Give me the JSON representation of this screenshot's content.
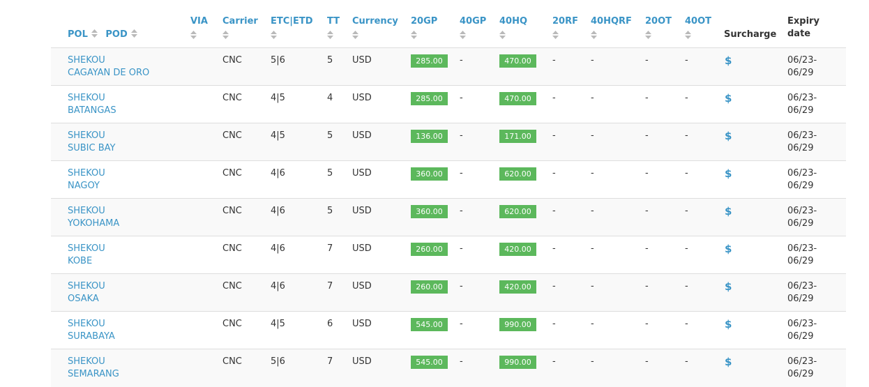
{
  "headers": {
    "pol": "POL",
    "pod": "POD",
    "via": "VIA",
    "carrier": "Carrier",
    "etc_etd": "ETC|ETD",
    "tt": "TT",
    "currency": "Currency",
    "c20gp": "20GP",
    "c40gp": "40GP",
    "c40hq": "40HQ",
    "c20rf": "20RF",
    "c40hqrf": "40HQRF",
    "c20ot": "20OT",
    "c40ot": "40OT",
    "surcharge": "Surcharge",
    "expiry_line1": "Expiry",
    "expiry_line2": "date"
  },
  "icons": {
    "sort": "sort-icon",
    "surcharge": "dollar-icon"
  },
  "colors": {
    "link": "#3a94c6",
    "badge": "#5cb85c",
    "row_stripe": "#f9f9f9"
  },
  "rows": [
    {
      "pol": "SHEKOU",
      "pod": "CAGAYAN DE ORO",
      "via": "",
      "carrier": "CNC",
      "etc_etd": "5|6",
      "tt": "5",
      "currency": "USD",
      "c20gp": "285.00",
      "c40gp": "-",
      "c40hq": "470.00",
      "c20rf": "-",
      "c40hqrf": "-",
      "c20ot": "-",
      "c40ot": "-",
      "surcharge": "$",
      "expiry_line1": "06/23-",
      "expiry_line2": "06/29"
    },
    {
      "pol": "SHEKOU",
      "pod": "BATANGAS",
      "via": "",
      "carrier": "CNC",
      "etc_etd": "4|5",
      "tt": "4",
      "currency": "USD",
      "c20gp": "285.00",
      "c40gp": "-",
      "c40hq": "470.00",
      "c20rf": "-",
      "c40hqrf": "-",
      "c20ot": "-",
      "c40ot": "-",
      "surcharge": "$",
      "expiry_line1": "06/23-",
      "expiry_line2": "06/29"
    },
    {
      "pol": "SHEKOU",
      "pod": "SUBIC BAY",
      "via": "",
      "carrier": "CNC",
      "etc_etd": "4|5",
      "tt": "5",
      "currency": "USD",
      "c20gp": "136.00",
      "c40gp": "-",
      "c40hq": "171.00",
      "c20rf": "-",
      "c40hqrf": "-",
      "c20ot": "-",
      "c40ot": "-",
      "surcharge": "$",
      "expiry_line1": "06/23-",
      "expiry_line2": "06/29"
    },
    {
      "pol": "SHEKOU",
      "pod": "NAGOY",
      "via": "",
      "carrier": "CNC",
      "etc_etd": "4|6",
      "tt": "5",
      "currency": "USD",
      "c20gp": "360.00",
      "c40gp": "-",
      "c40hq": "620.00",
      "c20rf": "-",
      "c40hqrf": "-",
      "c20ot": "-",
      "c40ot": "-",
      "surcharge": "$",
      "expiry_line1": "06/23-",
      "expiry_line2": "06/29"
    },
    {
      "pol": "SHEKOU",
      "pod": "YOKOHAMA",
      "via": "",
      "carrier": "CNC",
      "etc_etd": "4|6",
      "tt": "5",
      "currency": "USD",
      "c20gp": "360.00",
      "c40gp": "-",
      "c40hq": "620.00",
      "c20rf": "-",
      "c40hqrf": "-",
      "c20ot": "-",
      "c40ot": "-",
      "surcharge": "$",
      "expiry_line1": "06/23-",
      "expiry_line2": "06/29"
    },
    {
      "pol": "SHEKOU",
      "pod": "KOBE",
      "via": "",
      "carrier": "CNC",
      "etc_etd": "4|6",
      "tt": "7",
      "currency": "USD",
      "c20gp": "260.00",
      "c40gp": "-",
      "c40hq": "420.00",
      "c20rf": "-",
      "c40hqrf": "-",
      "c20ot": "-",
      "c40ot": "-",
      "surcharge": "$",
      "expiry_line1": "06/23-",
      "expiry_line2": "06/29"
    },
    {
      "pol": "SHEKOU",
      "pod": "OSAKA",
      "via": "",
      "carrier": "CNC",
      "etc_etd": "4|6",
      "tt": "7",
      "currency": "USD",
      "c20gp": "260.00",
      "c40gp": "-",
      "c40hq": "420.00",
      "c20rf": "-",
      "c40hqrf": "-",
      "c20ot": "-",
      "c40ot": "-",
      "surcharge": "$",
      "expiry_line1": "06/23-",
      "expiry_line2": "06/29"
    },
    {
      "pol": "SHEKOU",
      "pod": "SURABAYA",
      "via": "",
      "carrier": "CNC",
      "etc_etd": "4|5",
      "tt": "6",
      "currency": "USD",
      "c20gp": "545.00",
      "c40gp": "-",
      "c40hq": "990.00",
      "c20rf": "-",
      "c40hqrf": "-",
      "c20ot": "-",
      "c40ot": "-",
      "surcharge": "$",
      "expiry_line1": "06/23-",
      "expiry_line2": "06/29"
    },
    {
      "pol": "SHEKOU",
      "pod": "SEMARANG",
      "via": "",
      "carrier": "CNC",
      "etc_etd": "5|6",
      "tt": "7",
      "currency": "USD",
      "c20gp": "545.00",
      "c40gp": "-",
      "c40hq": "990.00",
      "c20rf": "-",
      "c40hqrf": "-",
      "c20ot": "-",
      "c40ot": "-",
      "surcharge": "$",
      "expiry_line1": "06/23-",
      "expiry_line2": "06/29"
    }
  ]
}
